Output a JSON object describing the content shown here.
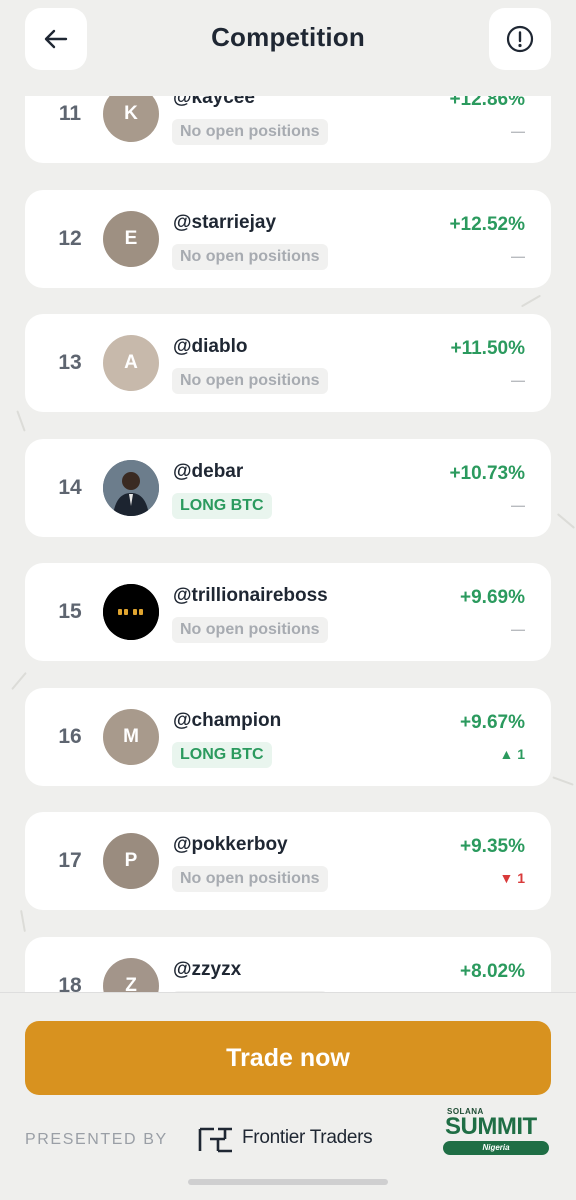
{
  "header": {
    "title": "Competition",
    "back_icon": "arrow-left-icon",
    "info_icon": "info-circle-icon"
  },
  "leaderboard": [
    {
      "rank": "11",
      "initial": "K",
      "avatar_color": "#a89a8c",
      "avatar_type": "initial",
      "username": "@kaycee",
      "status": "No open positions",
      "status_type": "none",
      "pct": "+12.86%",
      "change": "—",
      "change_type": "flat"
    },
    {
      "rank": "12",
      "initial": "E",
      "avatar_color": "#9e9082",
      "avatar_type": "initial",
      "username": "@starriejay",
      "status": "No open positions",
      "status_type": "none",
      "pct": "+12.52%",
      "change": "—",
      "change_type": "flat"
    },
    {
      "rank": "13",
      "initial": "A",
      "avatar_color": "#c7b9ab",
      "avatar_type": "initial",
      "username": "@diablo",
      "status": "No open positions",
      "status_type": "none",
      "pct": "+11.50%",
      "change": "—",
      "change_type": "flat"
    },
    {
      "rank": "14",
      "initial": "",
      "avatar_color": "#5a6a78",
      "avatar_type": "photo",
      "username": "@debar",
      "status": "LONG BTC",
      "status_type": "long",
      "pct": "+10.73%",
      "change": "—",
      "change_type": "flat"
    },
    {
      "rank": "15",
      "initial": "",
      "avatar_color": "#000000",
      "avatar_type": "quote-logo",
      "username": "@trillionaireboss",
      "status": "No open positions",
      "status_type": "none",
      "pct": "+9.69%",
      "change": "—",
      "change_type": "flat"
    },
    {
      "rank": "16",
      "initial": "M",
      "avatar_color": "#a89a8c",
      "avatar_type": "initial",
      "username": "@champion",
      "status": "LONG BTC",
      "status_type": "long",
      "pct": "+9.67%",
      "change": "▲ 1",
      "change_type": "up"
    },
    {
      "rank": "17",
      "initial": "P",
      "avatar_color": "#9a8c7f",
      "avatar_type": "initial",
      "username": "@pokkerboy",
      "status": "No open positions",
      "status_type": "none",
      "pct": "+9.35%",
      "change": "▼ 1",
      "change_type": "down"
    },
    {
      "rank": "18",
      "initial": "Z",
      "avatar_color": "#a3958a",
      "avatar_type": "initial",
      "username": "@zzyzx",
      "status": "No open positions",
      "status_type": "none",
      "pct": "+8.02%",
      "change": "",
      "change_type": "flat"
    }
  ],
  "footer": {
    "trade_button": "Trade now",
    "presented_by": "PRESENTED BY",
    "sponsor_name": "Frontier Traders",
    "summit_logo": {
      "top": "SOLANA",
      "word": "SUMMIT",
      "sub": "Nigeria"
    }
  },
  "colors": {
    "positive": "#2b9a5e",
    "negative": "#d93a3a",
    "accent_button": "#d8921f"
  }
}
